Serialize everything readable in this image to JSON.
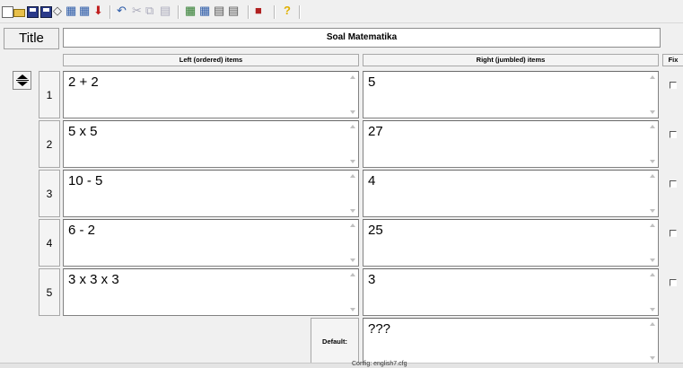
{
  "toolbar": {
    "icons": [
      "new-document-icon",
      "open-folder-icon",
      "save-icon",
      "save-as-icon",
      "eraser-icon",
      "image-icon",
      "settings-icon",
      "paste-icon",
      "undo-icon",
      "cut-icon",
      "copy-icon",
      "paste-clip-icon",
      "grid-icon",
      "tile-icon",
      "group-icon",
      "cascade-icon",
      "quiz-icon",
      "help-icon"
    ],
    "help_glyph": "?"
  },
  "title": {
    "label": "Title",
    "value": "Soal Matematika"
  },
  "columns": {
    "left": "Left (ordered) items",
    "right": "Right (jumbled) items",
    "fix": "Fix"
  },
  "rows": [
    {
      "num": "1",
      "left": "2 + 2",
      "right": "5"
    },
    {
      "num": "2",
      "left": "5 x 5",
      "right": "27"
    },
    {
      "num": "3",
      "left": "10 - 5",
      "right": "4"
    },
    {
      "num": "4",
      "left": "6 - 2",
      "right": "25"
    },
    {
      "num": "5",
      "left": "3 x 3 x 3",
      "right": "3"
    }
  ],
  "default": {
    "label": "Default:",
    "value": "???"
  },
  "status": {
    "config_file": "Config: english7.cfg"
  },
  "colors": {
    "accent_red": "#c02020",
    "help_yellow": "#e0b000"
  }
}
